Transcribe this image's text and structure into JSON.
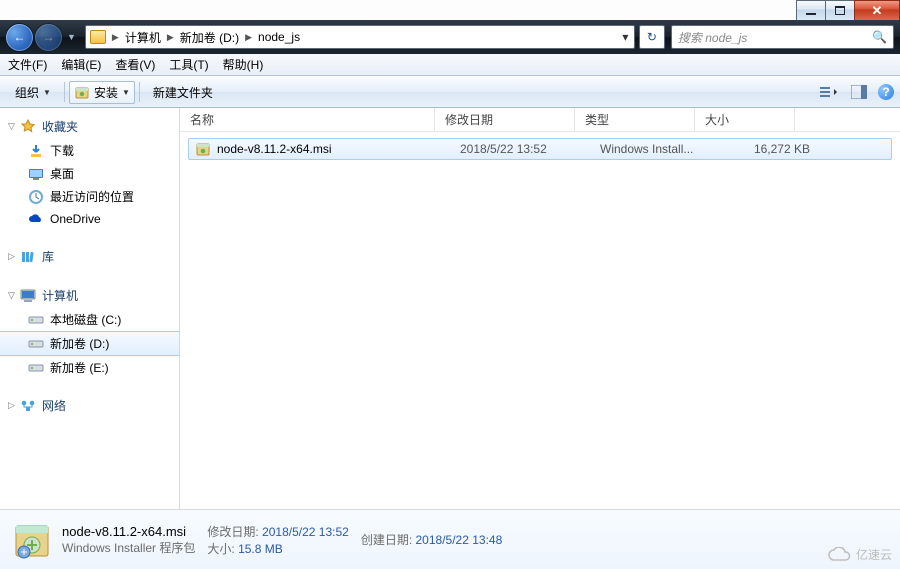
{
  "caption": {
    "min": "minimize",
    "max": "maximize",
    "close": "close"
  },
  "nav": {
    "back": "←",
    "forward": "→",
    "crumbs": [
      "计算机",
      "新加卷 (D:)",
      "node_js"
    ],
    "refresh": "↻"
  },
  "search": {
    "placeholder": "搜索 node_js"
  },
  "menu": {
    "file": "文件(F)",
    "edit": "编辑(E)",
    "view": "查看(V)",
    "tools": "工具(T)",
    "help": "帮助(H)"
  },
  "toolbar": {
    "organize": "组织",
    "install": "安装",
    "newfolder": "新建文件夹"
  },
  "columns": {
    "name": "名称",
    "date": "修改日期",
    "type": "类型",
    "size": "大小"
  },
  "sidebar": {
    "fav": {
      "label": "收藏夹",
      "items": [
        {
          "id": "downloads",
          "label": "下载"
        },
        {
          "id": "desktop",
          "label": "桌面"
        },
        {
          "id": "recent",
          "label": "最近访问的位置"
        },
        {
          "id": "onedrive",
          "label": "OneDrive"
        }
      ]
    },
    "lib": {
      "label": "库"
    },
    "computer": {
      "label": "计算机",
      "drives": [
        {
          "id": "c",
          "label": "本地磁盘 (C:)"
        },
        {
          "id": "d",
          "label": "新加卷 (D:)",
          "selected": true
        },
        {
          "id": "e",
          "label": "新加卷 (E:)"
        }
      ]
    },
    "network": {
      "label": "网络"
    }
  },
  "files": [
    {
      "name": "node-v8.11.2-x64.msi",
      "date": "2018/5/22 13:52",
      "type": "Windows Install...",
      "size": "16,272 KB"
    }
  ],
  "details": {
    "title": "node-v8.11.2-x64.msi",
    "subtitle": "Windows Installer 程序包",
    "mod_k": "修改日期:",
    "mod_v": "2018/5/22 13:52",
    "size_k": "大小:",
    "size_v": "15.8 MB",
    "created_k": "创建日期:",
    "created_v": "2018/5/22 13:48"
  },
  "watermark": "亿速云"
}
